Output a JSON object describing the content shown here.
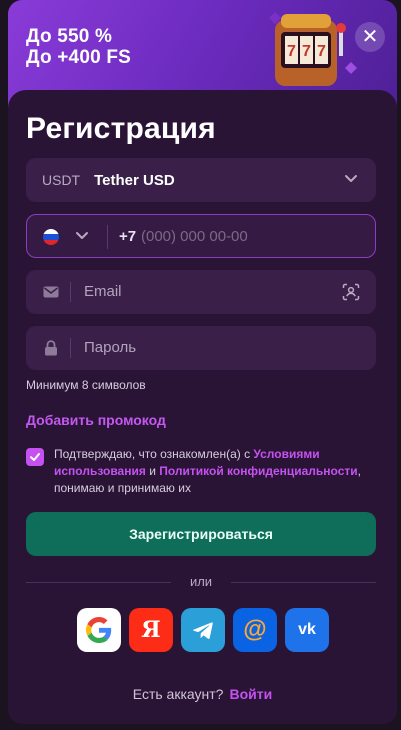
{
  "promo": {
    "line1": "До 550 %",
    "line2": "До +400 FS",
    "slot_digits": "777"
  },
  "close_icon": "close-icon",
  "form": {
    "title": "Регистрация",
    "currency": {
      "code": "USDT",
      "name": "Tether USD"
    },
    "phone": {
      "country": "RU",
      "prefix": "+7",
      "placeholder": "(000) 000 00-00"
    },
    "email": {
      "placeholder": "Email"
    },
    "password": {
      "placeholder": "Пароль",
      "hint": "Минимум 8 символов"
    },
    "promo_link": "Добавить промокод",
    "agree": {
      "checked": true,
      "text_before": "Подтверждаю, что ознакомлен(а) с ",
      "terms": "Условиями использования",
      "and": " и ",
      "privacy": "Политикой конфиденциальности",
      "text_after": ", понимаю и принимаю их"
    },
    "register_button": "Зарегистрироваться",
    "or_label": "или",
    "socials": [
      {
        "name": "google",
        "label": "G"
      },
      {
        "name": "yandex",
        "label": "Я"
      },
      {
        "name": "telegram",
        "label": ""
      },
      {
        "name": "mailru",
        "label": "@"
      },
      {
        "name": "vk",
        "label": "vk"
      }
    ],
    "footer": {
      "question": "Есть аккаунт?",
      "login": "Войти"
    }
  },
  "colors": {
    "accent": "#c552f0",
    "register_bg": "#0e6e5a",
    "card_bg": "#2a1436",
    "field_bg": "#3a2048"
  }
}
